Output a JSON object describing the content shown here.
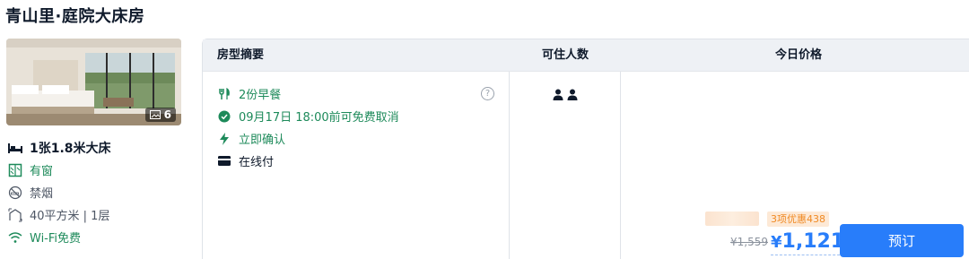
{
  "room": {
    "title": "青山里·庭院大床房",
    "photo_count": "6",
    "facilities": {
      "bed": "1张1.8米大床",
      "window": "有窗",
      "smoking": "禁烟",
      "area": "40平方米 | 1层",
      "wifi": "Wi-Fi免费"
    }
  },
  "table": {
    "headers": {
      "summary": "房型摘要",
      "occupancy": "可住人数",
      "price": "今日价格"
    },
    "benefits": {
      "breakfast": "2份早餐",
      "cancel": "09月17日 18:00前可免费取消",
      "confirm": "立即确认",
      "payment": "在线付"
    },
    "help_glyph": "?",
    "promo": "3项优惠438",
    "original_price": "¥1,559",
    "currency": "¥",
    "price": "1,121",
    "book_label": "预订"
  },
  "colors": {
    "accent": "#287dfa",
    "green": "#1d8a5a",
    "promo": "#f08a24"
  }
}
